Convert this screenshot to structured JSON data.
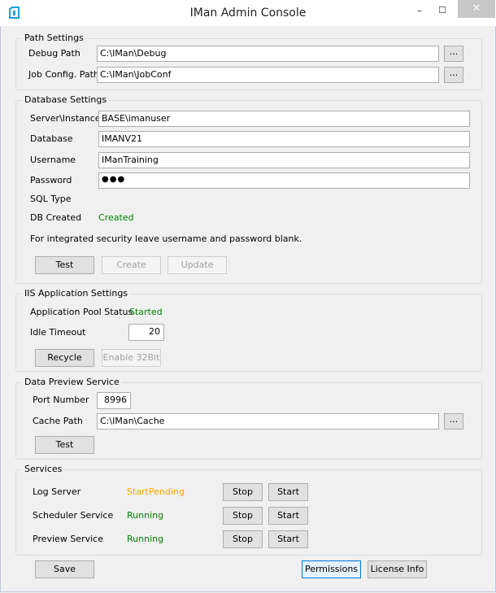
{
  "window": {
    "title": "IMan Admin Console",
    "minimize": "–",
    "maximize": "☐",
    "close": "✕"
  },
  "colors": {
    "status_green": "#008000",
    "status_orange": "#ffa500"
  },
  "path_settings": {
    "title": "Path Settings",
    "debug_path_label": "Debug Path",
    "debug_path_value": "C:\\IMan\\Debug",
    "job_config_label": "Job Config. Path",
    "job_config_value": "C:\\IMan\\JobConf",
    "browse_label": "..."
  },
  "database_settings": {
    "title": "Database Settings",
    "server_label": "Server\\Instance",
    "server_value": "BASE\\imanuser",
    "database_label": "Database",
    "database_value": "IMANV21",
    "username_label": "Username",
    "username_value": "IManTraining",
    "password_label": "Password",
    "password_value": "●●●",
    "sql_type_label": "SQL Type",
    "db_created_label": "DB Created",
    "db_created_value": "Created",
    "note": "For integrated security leave username and password blank.",
    "test_label": "Test",
    "create_label": "Create",
    "update_label": "Update"
  },
  "iis_settings": {
    "title": "IIS Application Settings",
    "pool_status_label": "Application Pool Status",
    "pool_status_value": "Started",
    "idle_timeout_label": "Idle Timeout",
    "idle_timeout_value": "20",
    "recycle_label": "Recycle",
    "enable32_label": "Enable 32Bit"
  },
  "data_preview": {
    "title": "Data Preview Service",
    "port_label": "Port Number",
    "port_value": "8996",
    "cache_label": "Cache Path",
    "cache_value": "C:\\IMan\\Cache",
    "browse_label": "...",
    "test_label": "Test"
  },
  "services": {
    "title": "Services",
    "stop_label": "Stop",
    "start_label": "Start",
    "items": [
      {
        "name": "Log Server",
        "status": "StartPending"
      },
      {
        "name": "Scheduler Service",
        "status": "Running"
      },
      {
        "name": "Preview Service",
        "status": "Running"
      }
    ]
  },
  "footer": {
    "save_label": "Save",
    "permissions_label": "Permissions",
    "license_label": "License Info"
  }
}
